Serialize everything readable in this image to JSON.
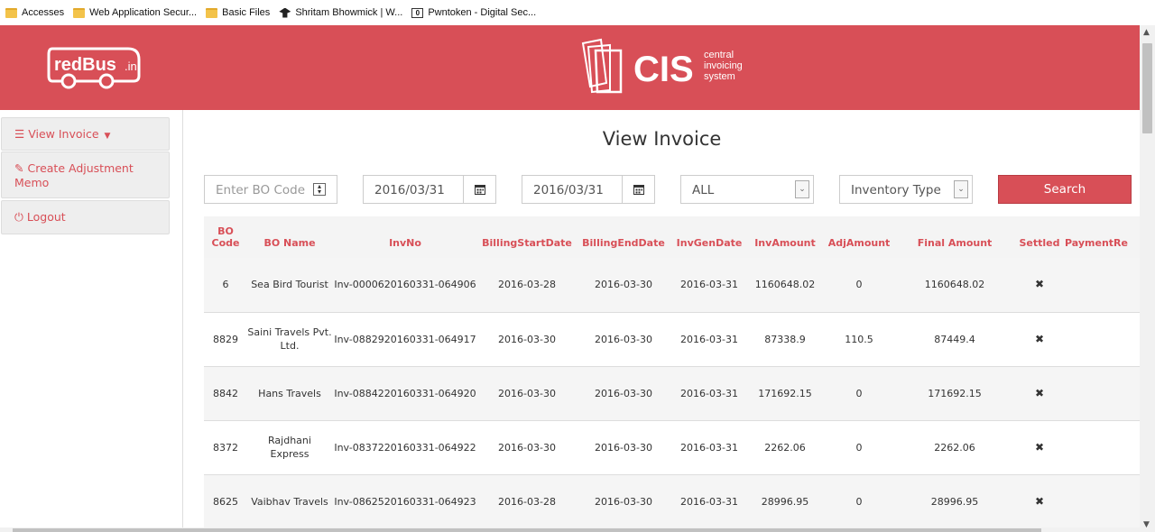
{
  "bookmarks": [
    {
      "label": "Accesses",
      "icon": "folder-icon"
    },
    {
      "label": "Web Application Secur...",
      "icon": "folder-icon"
    },
    {
      "label": "Basic Files",
      "icon": "folder-icon"
    },
    {
      "label": "Shritam Bhowmick | W...",
      "icon": "hat-icon"
    },
    {
      "label": "Pwntoken - Digital Sec...",
      "icon": "box-icon"
    }
  ],
  "header": {
    "brand_left": "redBus",
    "brand_left_suffix": ".in",
    "brand_right": "CIS",
    "brand_right_tagline": [
      "central",
      "invoicing",
      "system"
    ],
    "bg_color": "#d84f57"
  },
  "sidebar": {
    "items": [
      {
        "label": "View Invoice",
        "icon": "list-icon"
      },
      {
        "label": "Create Adjustment Memo",
        "icon": "edit-icon"
      },
      {
        "label": "Logout",
        "icon": "power-icon"
      }
    ]
  },
  "main": {
    "title": "View Invoice",
    "filters": {
      "bo_code_placeholder": "Enter BO Code",
      "start_date": "2016/03/31",
      "end_date": "2016/03/31",
      "status_select": "ALL",
      "inventory_select": "Inventory Type",
      "search_label": "Search"
    },
    "table": {
      "columns": [
        "BO Code",
        "BO Name",
        "InvNo",
        "BillingStartDate",
        "BillingEndDate",
        "InvGenDate",
        "InvAmount",
        "AdjAmount",
        "Final Amount",
        "Settled",
        "PaymentRe"
      ],
      "rows": [
        [
          "6",
          "Sea Bird Tourist",
          "Inv-0000620160331-064906",
          "2016-03-28",
          "2016-03-30",
          "2016-03-31",
          "1160648.02",
          "0",
          "1160648.02",
          "✖",
          ""
        ],
        [
          "8829",
          "Saini Travels Pvt. Ltd.",
          "Inv-0882920160331-064917",
          "2016-03-30",
          "2016-03-30",
          "2016-03-31",
          "87338.9",
          "110.5",
          "87449.4",
          "✖",
          ""
        ],
        [
          "8842",
          "Hans Travels",
          "Inv-0884220160331-064920",
          "2016-03-30",
          "2016-03-30",
          "2016-03-31",
          "171692.15",
          "0",
          "171692.15",
          "✖",
          ""
        ],
        [
          "8372",
          "Rajdhani Express",
          "Inv-0837220160331-064922",
          "2016-03-30",
          "2016-03-30",
          "2016-03-31",
          "2262.06",
          "0",
          "2262.06",
          "✖",
          ""
        ],
        [
          "8625",
          "Vaibhav Travels",
          "Inv-0862520160331-064923",
          "2016-03-28",
          "2016-03-30",
          "2016-03-31",
          "28996.95",
          "0",
          "28996.95",
          "✖",
          ""
        ]
      ]
    }
  }
}
